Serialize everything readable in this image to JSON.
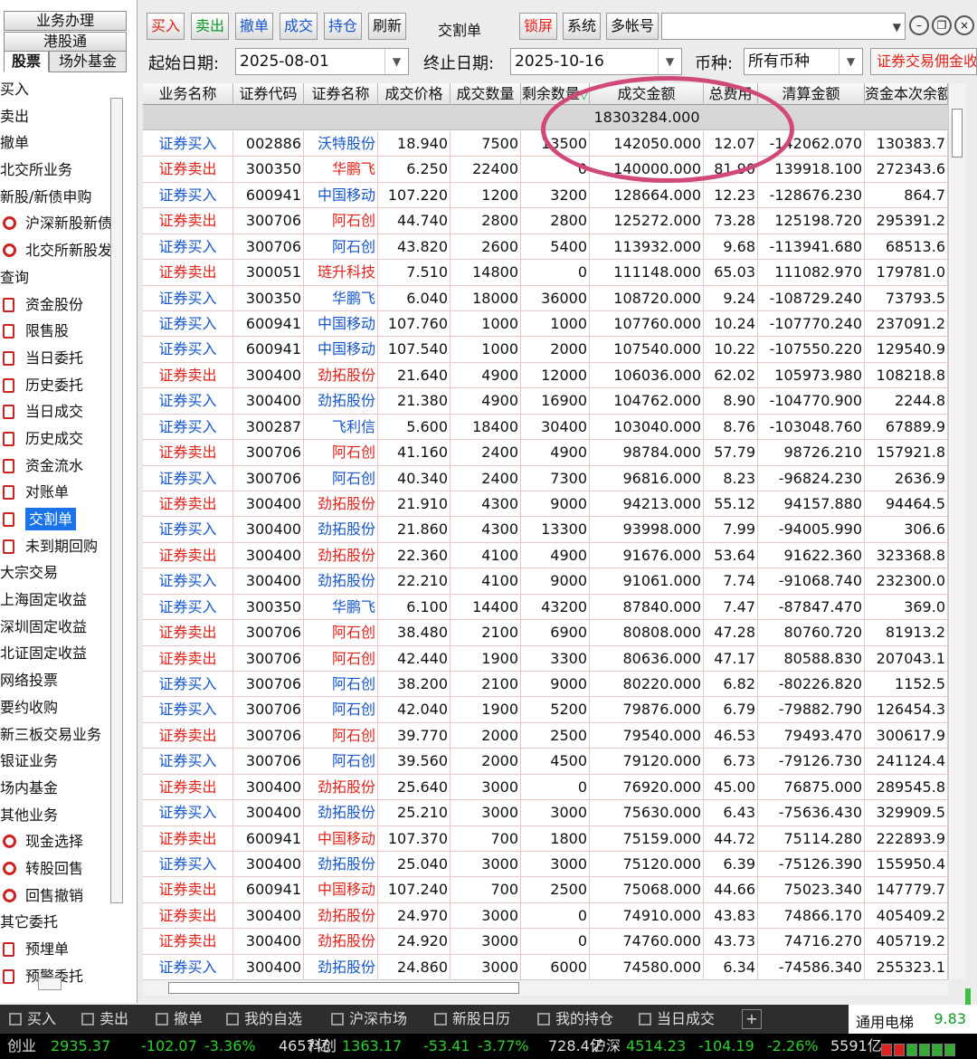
{
  "sidebar": {
    "top_buttons": [
      "业务办理",
      "港股通"
    ],
    "tabs": [
      {
        "label": "股票",
        "active": true
      },
      {
        "label": "场外基金",
        "active": false
      }
    ],
    "items": [
      {
        "label": "买入",
        "type": "cat"
      },
      {
        "label": "卖出",
        "type": "cat"
      },
      {
        "label": "撤单",
        "type": "cat"
      },
      {
        "label": "北交所业务",
        "type": "cat"
      },
      {
        "label": "新股/新债申购",
        "type": "cat"
      },
      {
        "label": "沪深新股新债",
        "type": "sub",
        "icon": "plus-gear-icon"
      },
      {
        "label": "北交所新股发",
        "type": "sub",
        "icon": "plus-gear-icon"
      },
      {
        "label": "查询",
        "type": "cat"
      },
      {
        "label": "资金股份",
        "type": "sub",
        "icon": "document-icon"
      },
      {
        "label": "限售股",
        "type": "sub",
        "icon": "document-icon"
      },
      {
        "label": "当日委托",
        "type": "sub",
        "icon": "document-icon"
      },
      {
        "label": "历史委托",
        "type": "sub",
        "icon": "document-icon"
      },
      {
        "label": "当日成交",
        "type": "sub",
        "icon": "document-icon"
      },
      {
        "label": "历史成交",
        "type": "sub",
        "icon": "document-icon"
      },
      {
        "label": "资金流水",
        "type": "sub",
        "icon": "document-icon"
      },
      {
        "label": "对账单",
        "type": "sub",
        "icon": "document-icon"
      },
      {
        "label": "交割单",
        "type": "sub",
        "icon": "document-icon",
        "selected": true
      },
      {
        "label": "未到期回购",
        "type": "sub",
        "icon": "document-icon"
      },
      {
        "label": "大宗交易",
        "type": "cat"
      },
      {
        "label": "上海固定收益",
        "type": "cat"
      },
      {
        "label": "深圳固定收益",
        "type": "cat"
      },
      {
        "label": "北证固定收益",
        "type": "cat"
      },
      {
        "label": "网络投票",
        "type": "cat"
      },
      {
        "label": "要约收购",
        "type": "cat"
      },
      {
        "label": "新三板交易业务",
        "type": "cat"
      },
      {
        "label": "银证业务",
        "type": "cat"
      },
      {
        "label": "场内基金",
        "type": "cat"
      },
      {
        "label": "其他业务",
        "type": "cat"
      },
      {
        "label": "现金选择",
        "type": "sub",
        "icon": "gear-icon"
      },
      {
        "label": "转股回售",
        "type": "sub",
        "icon": "gear-icon"
      },
      {
        "label": "回售撤销",
        "type": "sub",
        "icon": "gear-icon"
      },
      {
        "label": "其它委托",
        "type": "cat"
      },
      {
        "label": "预埋单",
        "type": "sub",
        "icon": "document-icon"
      },
      {
        "label": "预警委托",
        "type": "sub",
        "icon": "document-icon"
      }
    ]
  },
  "toolbar": {
    "buy": "买入",
    "sell": "卖出",
    "cancel": "撤单",
    "deal": "成交",
    "position": "持仓",
    "refresh": "刷新",
    "title": "交割单",
    "lock": "锁屏",
    "system": "系统",
    "multi": "多帐号"
  },
  "filters": {
    "start_label": "起始日期:",
    "start_value": "2025-08-01",
    "end_label": "终止日期:",
    "end_value": "2025-10-16",
    "currency_label": "币种:",
    "currency_value": "所有币种",
    "commission_link": "证券交易佣金收"
  },
  "table": {
    "headers": [
      "业务名称",
      "证券代码",
      "证券名称",
      "成交价格",
      "成交数量",
      "剩余数量",
      "成交金额",
      "总费用",
      "清算金额",
      "资金本次余额"
    ],
    "sort_indicator": "▽",
    "total_amount": "18303284.000",
    "rows": [
      {
        "op": "证券买入",
        "code": "002886",
        "name": "沃特股份",
        "price": "18.940",
        "qty": "7500",
        "remain": "13500",
        "amount": "142050.000",
        "fee": "12.07",
        "settle": "-142062.070",
        "balance": "130383.7",
        "side": "buy"
      },
      {
        "op": "证券卖出",
        "code": "300350",
        "name": "华鹏飞",
        "price": "6.250",
        "qty": "22400",
        "remain": "0",
        "amount": "140000.000",
        "fee": "81.90",
        "settle": "139918.100",
        "balance": "272343.6",
        "side": "sell"
      },
      {
        "op": "证券买入",
        "code": "600941",
        "name": "中国移动",
        "price": "107.220",
        "qty": "1200",
        "remain": "3200",
        "amount": "128664.000",
        "fee": "12.23",
        "settle": "-128676.230",
        "balance": "864.7",
        "side": "buy"
      },
      {
        "op": "证券卖出",
        "code": "300706",
        "name": "阿石创",
        "price": "44.740",
        "qty": "2800",
        "remain": "2800",
        "amount": "125272.000",
        "fee": "73.28",
        "settle": "125198.720",
        "balance": "295391.2",
        "side": "sell"
      },
      {
        "op": "证券买入",
        "code": "300706",
        "name": "阿石创",
        "price": "43.820",
        "qty": "2600",
        "remain": "5400",
        "amount": "113932.000",
        "fee": "9.68",
        "settle": "-113941.680",
        "balance": "68513.6",
        "side": "buy"
      },
      {
        "op": "证券卖出",
        "code": "300051",
        "name": "琏升科技",
        "price": "7.510",
        "qty": "14800",
        "remain": "0",
        "amount": "111148.000",
        "fee": "65.03",
        "settle": "111082.970",
        "balance": "179781.0",
        "side": "sell"
      },
      {
        "op": "证券买入",
        "code": "300350",
        "name": "华鹏飞",
        "price": "6.040",
        "qty": "18000",
        "remain": "36000",
        "amount": "108720.000",
        "fee": "9.24",
        "settle": "-108729.240",
        "balance": "73793.5",
        "side": "buy"
      },
      {
        "op": "证券买入",
        "code": "600941",
        "name": "中国移动",
        "price": "107.760",
        "qty": "1000",
        "remain": "1000",
        "amount": "107760.000",
        "fee": "10.24",
        "settle": "-107770.240",
        "balance": "237091.2",
        "side": "buy"
      },
      {
        "op": "证券买入",
        "code": "600941",
        "name": "中国移动",
        "price": "107.540",
        "qty": "1000",
        "remain": "2000",
        "amount": "107540.000",
        "fee": "10.22",
        "settle": "-107550.220",
        "balance": "129540.9",
        "side": "buy"
      },
      {
        "op": "证券卖出",
        "code": "300400",
        "name": "劲拓股份",
        "price": "21.640",
        "qty": "4900",
        "remain": "12000",
        "amount": "106036.000",
        "fee": "62.02",
        "settle": "105973.980",
        "balance": "108218.8",
        "side": "sell"
      },
      {
        "op": "证券买入",
        "code": "300400",
        "name": "劲拓股份",
        "price": "21.380",
        "qty": "4900",
        "remain": "16900",
        "amount": "104762.000",
        "fee": "8.90",
        "settle": "-104770.900",
        "balance": "2244.8",
        "side": "buy"
      },
      {
        "op": "证券买入",
        "code": "300287",
        "name": "飞利信",
        "price": "5.600",
        "qty": "18400",
        "remain": "30400",
        "amount": "103040.000",
        "fee": "8.76",
        "settle": "-103048.760",
        "balance": "67889.9",
        "side": "buy"
      },
      {
        "op": "证券卖出",
        "code": "300706",
        "name": "阿石创",
        "price": "41.160",
        "qty": "2400",
        "remain": "4900",
        "amount": "98784.000",
        "fee": "57.79",
        "settle": "98726.210",
        "balance": "157921.8",
        "side": "sell"
      },
      {
        "op": "证券买入",
        "code": "300706",
        "name": "阿石创",
        "price": "40.340",
        "qty": "2400",
        "remain": "7300",
        "amount": "96816.000",
        "fee": "8.23",
        "settle": "-96824.230",
        "balance": "2636.9",
        "side": "buy"
      },
      {
        "op": "证券卖出",
        "code": "300400",
        "name": "劲拓股份",
        "price": "21.910",
        "qty": "4300",
        "remain": "9000",
        "amount": "94213.000",
        "fee": "55.12",
        "settle": "94157.880",
        "balance": "94464.5",
        "side": "sell"
      },
      {
        "op": "证券买入",
        "code": "300400",
        "name": "劲拓股份",
        "price": "21.860",
        "qty": "4300",
        "remain": "13300",
        "amount": "93998.000",
        "fee": "7.99",
        "settle": "-94005.990",
        "balance": "306.6",
        "side": "buy"
      },
      {
        "op": "证券卖出",
        "code": "300400",
        "name": "劲拓股份",
        "price": "22.360",
        "qty": "4100",
        "remain": "4900",
        "amount": "91676.000",
        "fee": "53.64",
        "settle": "91622.360",
        "balance": "323368.8",
        "side": "sell"
      },
      {
        "op": "证券买入",
        "code": "300400",
        "name": "劲拓股份",
        "price": "22.210",
        "qty": "4100",
        "remain": "9000",
        "amount": "91061.000",
        "fee": "7.74",
        "settle": "-91068.740",
        "balance": "232300.0",
        "side": "buy"
      },
      {
        "op": "证券买入",
        "code": "300350",
        "name": "华鹏飞",
        "price": "6.100",
        "qty": "14400",
        "remain": "43200",
        "amount": "87840.000",
        "fee": "7.47",
        "settle": "-87847.470",
        "balance": "369.0",
        "side": "buy"
      },
      {
        "op": "证券卖出",
        "code": "300706",
        "name": "阿石创",
        "price": "38.480",
        "qty": "2100",
        "remain": "6900",
        "amount": "80808.000",
        "fee": "47.28",
        "settle": "80760.720",
        "balance": "81913.2",
        "side": "sell"
      },
      {
        "op": "证券卖出",
        "code": "300706",
        "name": "阿石创",
        "price": "42.440",
        "qty": "1900",
        "remain": "3300",
        "amount": "80636.000",
        "fee": "47.17",
        "settle": "80588.830",
        "balance": "207043.1",
        "side": "sell"
      },
      {
        "op": "证券买入",
        "code": "300706",
        "name": "阿石创",
        "price": "38.200",
        "qty": "2100",
        "remain": "9000",
        "amount": "80220.000",
        "fee": "6.82",
        "settle": "-80226.820",
        "balance": "1152.5",
        "side": "buy"
      },
      {
        "op": "证券买入",
        "code": "300706",
        "name": "阿石创",
        "price": "42.040",
        "qty": "1900",
        "remain": "5200",
        "amount": "79876.000",
        "fee": "6.79",
        "settle": "-79882.790",
        "balance": "126454.3",
        "side": "buy"
      },
      {
        "op": "证券卖出",
        "code": "300706",
        "name": "阿石创",
        "price": "39.770",
        "qty": "2000",
        "remain": "2500",
        "amount": "79540.000",
        "fee": "46.53",
        "settle": "79493.470",
        "balance": "300617.9",
        "side": "sell"
      },
      {
        "op": "证券买入",
        "code": "300706",
        "name": "阿石创",
        "price": "39.560",
        "qty": "2000",
        "remain": "4500",
        "amount": "79120.000",
        "fee": "6.73",
        "settle": "-79126.730",
        "balance": "241124.4",
        "side": "buy"
      },
      {
        "op": "证券卖出",
        "code": "300400",
        "name": "劲拓股份",
        "price": "25.640",
        "qty": "3000",
        "remain": "0",
        "amount": "76920.000",
        "fee": "45.00",
        "settle": "76875.000",
        "balance": "289545.8",
        "side": "sell"
      },
      {
        "op": "证券买入",
        "code": "300400",
        "name": "劲拓股份",
        "price": "25.210",
        "qty": "3000",
        "remain": "3000",
        "amount": "75630.000",
        "fee": "6.43",
        "settle": "-75636.430",
        "balance": "329909.5",
        "side": "buy"
      },
      {
        "op": "证券卖出",
        "code": "600941",
        "name": "中国移动",
        "price": "107.370",
        "qty": "700",
        "remain": "1800",
        "amount": "75159.000",
        "fee": "44.72",
        "settle": "75114.280",
        "balance": "222893.9",
        "side": "sell"
      },
      {
        "op": "证券买入",
        "code": "300400",
        "name": "劲拓股份",
        "price": "25.040",
        "qty": "3000",
        "remain": "3000",
        "amount": "75120.000",
        "fee": "6.39",
        "settle": "-75126.390",
        "balance": "155950.4",
        "side": "buy"
      },
      {
        "op": "证券卖出",
        "code": "600941",
        "name": "中国移动",
        "price": "107.240",
        "qty": "700",
        "remain": "2500",
        "amount": "75068.000",
        "fee": "44.66",
        "settle": "75023.340",
        "balance": "147779.7",
        "side": "sell"
      },
      {
        "op": "证券卖出",
        "code": "300400",
        "name": "劲拓股份",
        "price": "24.970",
        "qty": "3000",
        "remain": "0",
        "amount": "74910.000",
        "fee": "43.83",
        "settle": "74866.170",
        "balance": "405409.2",
        "side": "sell"
      },
      {
        "op": "证券卖出",
        "code": "300400",
        "name": "劲拓股份",
        "price": "24.920",
        "qty": "3000",
        "remain": "0",
        "amount": "74760.000",
        "fee": "43.73",
        "settle": "74716.270",
        "balance": "405719.2",
        "side": "sell"
      },
      {
        "op": "证券买入",
        "code": "300400",
        "name": "劲拓股份",
        "price": "24.860",
        "qty": "3000",
        "remain": "6000",
        "amount": "74580.000",
        "fee": "6.34",
        "settle": "-74586.340",
        "balance": "255323.1",
        "side": "buy"
      }
    ]
  },
  "bottom_bar": {
    "items": [
      "买入",
      "卖出",
      "撤单",
      "我的自选",
      "沪深市场",
      "新股日历",
      "我的持仓",
      "当日成交"
    ],
    "ticker_name": "通用电梯",
    "ticker_value": "9.83"
  },
  "market": {
    "items": [
      {
        "name": "创业",
        "value": "2935.37",
        "change": "-102.07",
        "pct": "-3.36%",
        "volume": "4657亿"
      },
      {
        "name": "科创",
        "value": "1363.17",
        "change": "-53.41",
        "pct": "-3.77%",
        "volume": "728.4亿"
      },
      {
        "name": "沪深",
        "value": "4514.23",
        "change": "-104.19",
        "pct": "-2.26%",
        "volume": "5591亿"
      }
    ]
  },
  "colors": {
    "buy": "#1656c8",
    "sell": "#e0221b",
    "selected": "#1a73e8",
    "highlight_circle": "#d1497a",
    "market_down": "#2bd12b"
  }
}
